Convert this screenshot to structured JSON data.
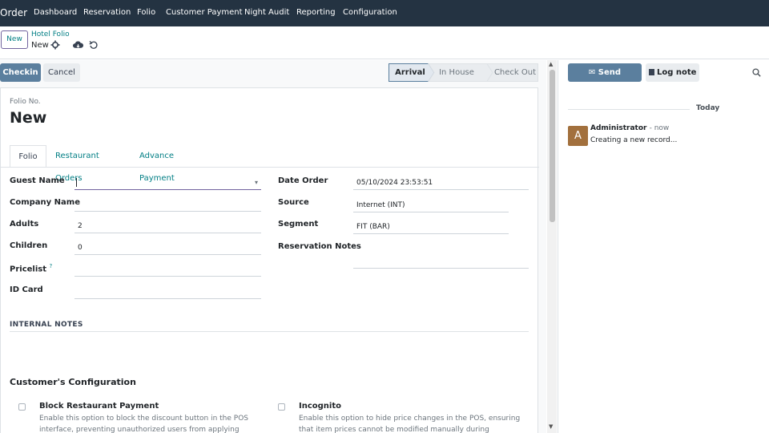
{
  "topnav": {
    "app_name": "Order",
    "menu": [
      "Dashboard",
      "Reservation",
      "Folio",
      "Customer Payment",
      "Night Audit",
      "Reporting",
      "Configuration"
    ]
  },
  "control_panel": {
    "new_button": "New",
    "breadcrumb_parent": "Hotel Folio",
    "breadcrumb_current": "New"
  },
  "actions": {
    "checkin": "Checkin",
    "cancel": "Cancel"
  },
  "statusbar": {
    "stages": [
      "Arrival",
      "In House",
      "Check Out"
    ],
    "active": "Arrival"
  },
  "form": {
    "folio_no_label": "Folio No.",
    "folio_no_value": "New",
    "tabs": [
      "Folio",
      "Restaurant Orders",
      "Advance Payment"
    ],
    "left_fields": [
      {
        "label": "Guest Name",
        "value": ""
      },
      {
        "label": "Company Name",
        "value": ""
      },
      {
        "label": "Adults",
        "value": "2"
      },
      {
        "label": "Children",
        "value": "0"
      },
      {
        "label": "Pricelist",
        "value": "",
        "help": "?"
      },
      {
        "label": "ID Card",
        "value": ""
      }
    ],
    "right_fields": [
      {
        "label": "Date Order",
        "value": "05/10/2024 23:53:51"
      },
      {
        "label": "Source",
        "value": "Internet (INT)"
      },
      {
        "label": "Segment",
        "value": "FIT (BAR)"
      },
      {
        "label": "Reservation Notes",
        "value": ""
      }
    ],
    "internal_notes_title": "INTERNAL NOTES",
    "customer_config_title": "Customer's Configuration",
    "options": [
      {
        "label": "Block Restaurant Payment",
        "desc_line1": "Enable this option to block the discount button in the POS",
        "desc_line2": "interface, preventing unauthorized users from applying"
      },
      {
        "label": "Incognito",
        "desc_line1": "Enable this option to hide price changes in the POS, ensuring",
        "desc_line2": "that item prices cannot be modified manually during"
      }
    ]
  },
  "chatter": {
    "send_message": "Send message",
    "log_note": "Log note",
    "today": "Today",
    "avatar_letter": "A",
    "author": "Administrator",
    "time": "- now",
    "message": "Creating a new record..."
  },
  "colors": {
    "navbar": "#243342",
    "primary_button": "#5b7f9e",
    "link": "#017e84",
    "avatar": "#a2703d"
  }
}
